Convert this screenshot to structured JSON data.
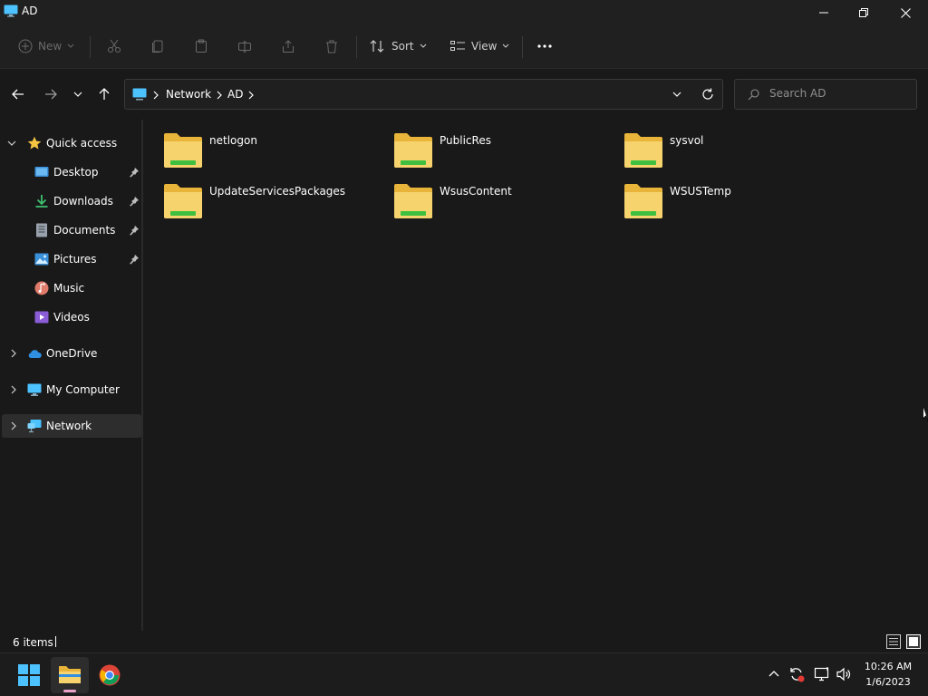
{
  "window": {
    "title": "AD"
  },
  "toolbar": {
    "new_label": "New",
    "sort_label": "Sort",
    "view_label": "View"
  },
  "address": {
    "segments": [
      "Network",
      "AD"
    ]
  },
  "search": {
    "placeholder": "Search AD"
  },
  "sidebar": {
    "quick_access": "Quick access",
    "items": [
      {
        "label": "Desktop",
        "icon": "desktop-icon",
        "pinned": true
      },
      {
        "label": "Downloads",
        "icon": "download-icon",
        "pinned": true
      },
      {
        "label": "Documents",
        "icon": "document-icon",
        "pinned": true
      },
      {
        "label": "Pictures",
        "icon": "pictures-icon",
        "pinned": true
      },
      {
        "label": "Music",
        "icon": "music-icon",
        "pinned": false
      },
      {
        "label": "Videos",
        "icon": "videos-icon",
        "pinned": false
      }
    ],
    "onedrive": "OneDrive",
    "my_computer": "My Computer",
    "network": "Network"
  },
  "content": {
    "folders": [
      "netlogon",
      "PublicRes",
      "sysvol",
      "UpdateServicesPackages",
      "WsusContent",
      "WSUSTemp"
    ]
  },
  "status": {
    "items_count": "6 items"
  },
  "taskbar": {
    "time": "10:26 AM",
    "date": "1/6/2023"
  },
  "colors": {
    "folder": "#f5c542",
    "folder_strip": "#3fbf3f",
    "accent": "#4cc2ff",
    "selected": "#2d2d2d"
  }
}
